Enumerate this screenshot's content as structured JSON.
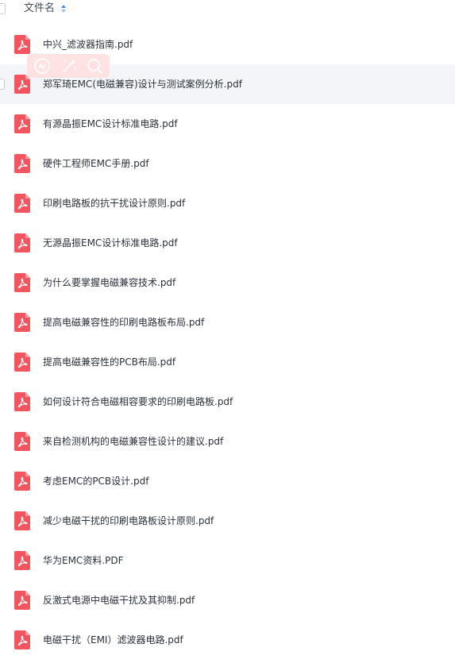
{
  "header": {
    "column_label": "文件名",
    "sort_icon": "sort-toggle-icon"
  },
  "files": [
    {
      "name": "中兴_滤波器指南.pdf",
      "icon": "pdf-file-icon"
    },
    {
      "name": "郑军琦EMC(电磁兼容)设计与测试案例分析.pdf",
      "icon": "pdf-file-icon"
    },
    {
      "name": "有源晶振EMC设计标准电路.pdf",
      "icon": "pdf-file-icon"
    },
    {
      "name": "硬件工程师EMC手册.pdf",
      "icon": "pdf-file-icon"
    },
    {
      "name": "印刷电路板的抗干扰设计原则.pdf",
      "icon": "pdf-file-icon"
    },
    {
      "name": "无源晶振EMC设计标准电路.pdf",
      "icon": "pdf-file-icon"
    },
    {
      "name": "为什么要掌握电磁兼容技术.pdf",
      "icon": "pdf-file-icon"
    },
    {
      "name": "提高电磁兼容性的印刷电路板布局.pdf",
      "icon": "pdf-file-icon"
    },
    {
      "name": "提高电磁兼容性的PCB布局.pdf",
      "icon": "pdf-file-icon"
    },
    {
      "name": "如何设计符合电磁相容要求的印刷电路板.pdf",
      "icon": "pdf-file-icon"
    },
    {
      "name": "来自检测机构的电磁兼容性设计的建议.pdf",
      "icon": "pdf-file-icon"
    },
    {
      "name": "考虑EMC的PCB设计.pdf",
      "icon": "pdf-file-icon"
    },
    {
      "name": "减少电磁干扰的印刷电路板设计原则.pdf",
      "icon": "pdf-file-icon"
    },
    {
      "name": "华为EMC资料.PDF",
      "icon": "pdf-file-icon"
    },
    {
      "name": "反激式电源中电磁干扰及其抑制.pdf",
      "icon": "pdf-file-icon"
    },
    {
      "name": "电磁干扰（EMI）滤波器电路.pdf",
      "icon": "pdf-file-icon"
    }
  ],
  "hover_toolbar": {
    "ai_label": "AI",
    "tools": [
      "ai-assistant-icon",
      "magic-wand-icon",
      "search-icon"
    ]
  },
  "colors": {
    "pdf_icon": "#f2555f",
    "row_hover": "#f3f5f8",
    "toolbar_bg": "#ffdede",
    "toolbar_glyph": "#ffffff",
    "text": "#2b313b",
    "sort_icon": "#4a8af4"
  }
}
